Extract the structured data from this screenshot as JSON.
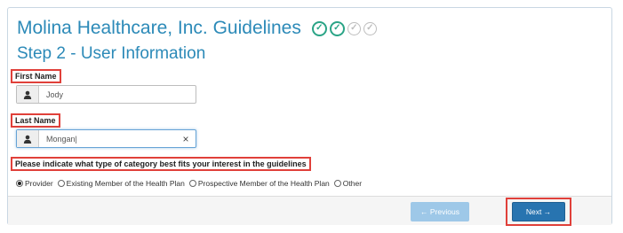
{
  "header": {
    "title": "Molina Healthcare, Inc. Guidelines",
    "steps": [
      "done",
      "done",
      "todo",
      "todo"
    ]
  },
  "step": {
    "title": "Step 2 - User Information"
  },
  "fields": {
    "first_name": {
      "label": "First Name",
      "value": "Jody",
      "icon": "user-icon"
    },
    "last_name": {
      "label": "Last Name",
      "value": "Mongan|",
      "icon": "user-icon",
      "clear": "×"
    }
  },
  "category": {
    "question": "Please indicate what type of category best fits your interest in the guidelines",
    "options": [
      {
        "label": "Provider",
        "checked": true
      },
      {
        "label": "Existing Member of the Health Plan",
        "checked": false
      },
      {
        "label": "Prospective Member of the Health Plan",
        "checked": false
      },
      {
        "label": "Other",
        "checked": false
      }
    ]
  },
  "footer": {
    "previous_label": "← Previous",
    "next_label": "Next →"
  },
  "colors": {
    "accent": "#2c8ab8",
    "highlight": "#e0403a",
    "primary_button": "#2874b0",
    "disabled_button": "#9ec8e8",
    "step_done": "#2aa486"
  }
}
